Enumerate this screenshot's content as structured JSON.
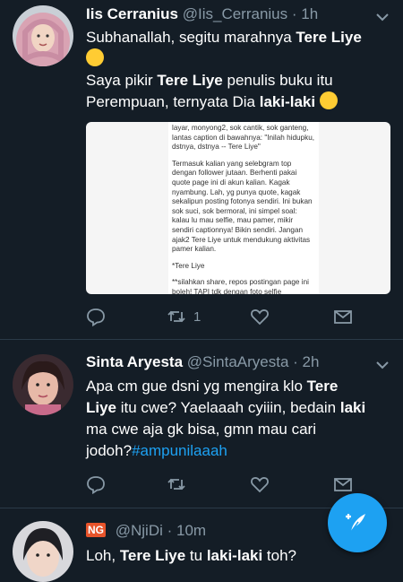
{
  "tweets": [
    {
      "name": "Iis Cerranius",
      "handle": "@Iis_Cerranius",
      "time": "· 1h",
      "text_line1_pre": "Subhanallah, segitu marahnya ",
      "text_line1_bold": "Tere Liye",
      "text_line2_pre": "Saya pikir ",
      "text_line2_bold": "Tere Liye",
      "text_line2_post": " penulis buku itu",
      "text_line3_pre": "Perempuan, ternyata Dia ",
      "text_line3_bold": "laki-laki",
      "media_text": [
        "layar, monyong2, sok cantik, sok ganteng, lantas caption di bawahnya: \"Inilah hidupku, dstnya, dstnya -- Tere Liye\"",
        "Termasuk kalian yang selebgram top dengan follower jutaan. Berhenti pakai quote page ini di akun kalian. Kagak nyambung. Lah, yg punya quote, kagak sekalipun posting fotonya sendiri. Ini bukan sok suci, sok bermoral, ini simpel soal: kalau lu mau selfie, mau pamer, mikir sendiri captionnya! Bikin sendiri. Jangan ajak2 Tere Liye untuk mendukung aktivitas pamer kalian.",
        "*Tere Liye",
        "**silahkan share, repos postingan page ini boleh! TAPI tdk dengan foto selfie"
      ],
      "retweet_count": "1"
    },
    {
      "name": "Sinta Aryesta",
      "handle": "@SintaAryesta",
      "time": "· 2h",
      "l1_pre": "Apa cm gue dsni yg mengira klo ",
      "l1_bold": "Tere",
      "l2_bold": "Liye",
      "l2_pre": " itu cwe? Yaelaaah cyiiin, bedain ",
      "l2_bold2": "laki",
      "l3": "ma cwe aja gk bisa, gmn mau cari",
      "l4_pre": "jodoh?",
      "hashtag": "#ampunilaaah"
    },
    {
      "badge": "NG",
      "handle": "@NjiDi",
      "time": "· 10m",
      "text_pre": "Loh, ",
      "text_bold1": "Tere Liye",
      "text_mid": " tu ",
      "text_bold2": "laki-laki",
      "text_post": " toh?"
    }
  ],
  "colors": {
    "background": "#141d26",
    "accent": "#1da1f2",
    "muted": "#8899a6"
  },
  "icons": [
    "reply-icon",
    "retweet-icon",
    "like-icon",
    "dm-icon",
    "chevron-down-icon",
    "compose-icon"
  ]
}
